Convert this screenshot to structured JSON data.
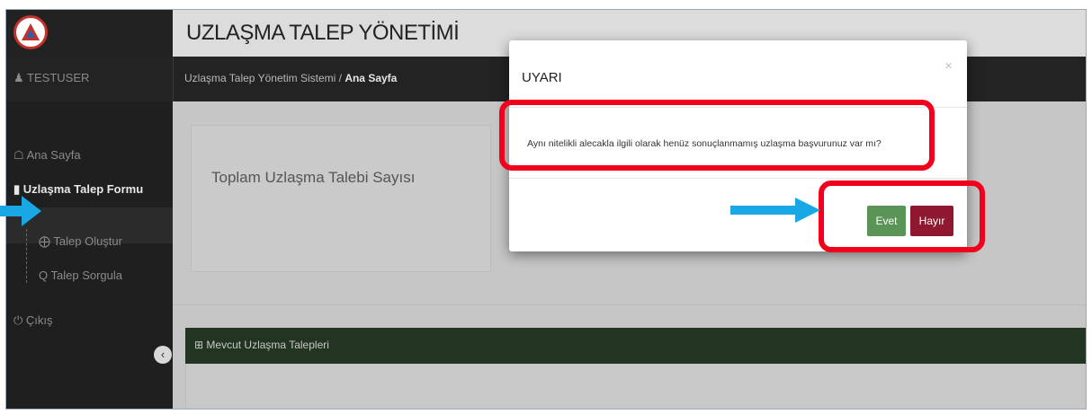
{
  "header": {
    "app_title": "UZLAŞMA TALEP YÖNETİMİ"
  },
  "user": {
    "name": "TESTUSER",
    "icon": "user-icon"
  },
  "breadcrumb": {
    "root": "Uzlaşma Talep Yönetim Sistemi /",
    "current": "Ana Sayfa"
  },
  "sidebar": {
    "items": [
      {
        "label": "Ana Sayfa",
        "icon": "home-icon"
      },
      {
        "label": "Uzlaşma Talep Formu",
        "icon": "document-icon"
      },
      {
        "label": "Talep Oluştur",
        "icon": "plus-circle-icon"
      },
      {
        "label": "Talep Sorgula",
        "icon": "search-icon"
      },
      {
        "label": "Çıkış",
        "icon": "power-icon"
      }
    ],
    "collapse_icon": "chevron-left-icon"
  },
  "main": {
    "card_title": "Toplam Uzlaşma Talebi Sayısı",
    "panel_title": "Mevcut Uzlaşma Talepleri",
    "panel_icon": "table-icon"
  },
  "modal": {
    "title": "UYARI",
    "close": "×",
    "message": "Aynı nitelikli alecakla ilgili olarak henüz sonuçlanmamış uzlaşma başvurunuz var mı?",
    "yes_label": "Evet",
    "no_label": "Hayır"
  },
  "colors": {
    "sidebar_bg": "#1f1f1f",
    "panel_header": "#223422",
    "yes_button": "#5a9456",
    "no_button": "#8f1830",
    "highlight": "#f2001b",
    "arrow": "#1aa7e6"
  }
}
